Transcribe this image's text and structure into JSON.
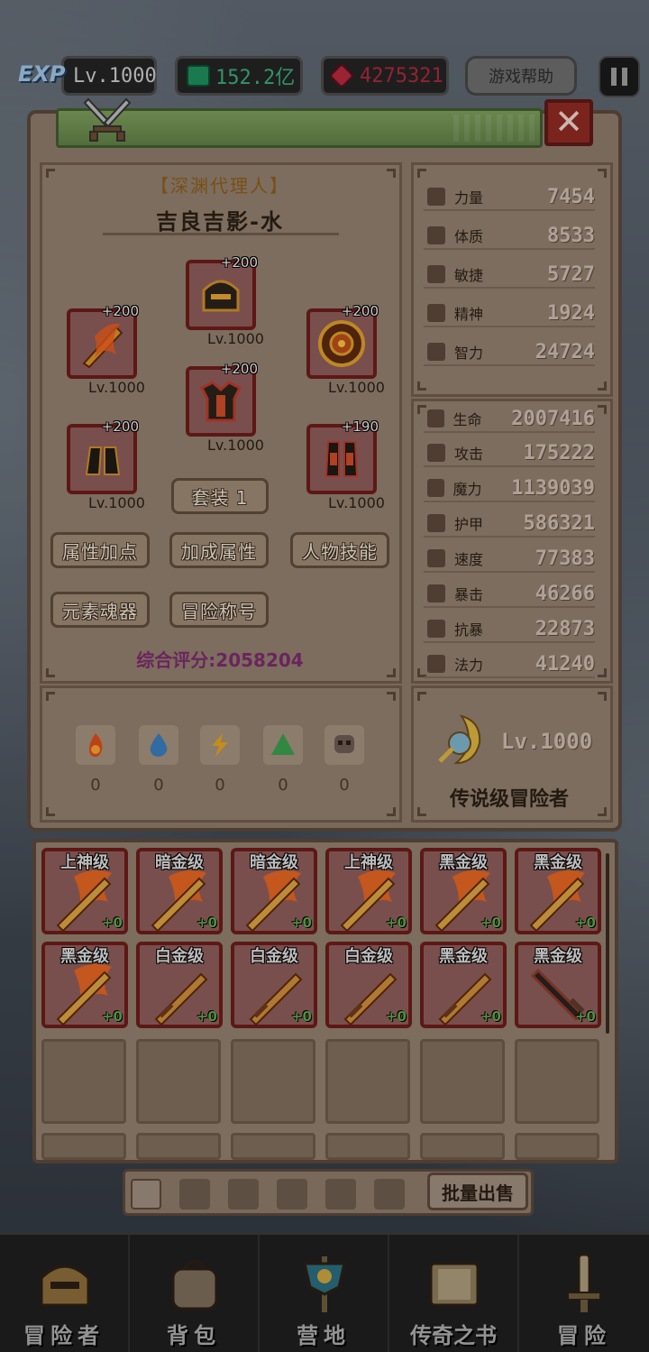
{
  "topbar": {
    "exp_badge": "EXP",
    "level": "Lv.1000",
    "gems": "152.2亿",
    "rubies": "4275321",
    "help": "游戏帮助"
  },
  "character": {
    "title": "【深渊代理人】",
    "name": "吉良吉影-水",
    "equipment": [
      {
        "plus": "+200",
        "level": "Lv.1000",
        "icon": "flame-sword-icon"
      },
      {
        "plus": "+200",
        "level": "Lv.1000",
        "icon": "helmet-icon"
      },
      {
        "plus": "+200",
        "level": "Lv.1000",
        "icon": "shield-icon"
      },
      {
        "plus": "+200",
        "level": "Lv.1000",
        "icon": "armor-icon"
      },
      {
        "plus": "+200",
        "level": "Lv.1000",
        "icon": "gauntlets-icon"
      },
      {
        "plus": "+190",
        "level": "Lv.1000",
        "icon": "boots-icon"
      }
    ],
    "set_button": "套装 1",
    "buttons": [
      "属性加点",
      "加成属性",
      "人物技能",
      "元素魂器",
      "冒险称号"
    ],
    "score": "综合评分:2058204"
  },
  "elements": [
    {
      "icon": "fire-element-icon",
      "value": "0"
    },
    {
      "icon": "water-element-icon",
      "value": "0"
    },
    {
      "icon": "thunder-element-icon",
      "value": "0"
    },
    {
      "icon": "wind-element-icon",
      "value": "0"
    },
    {
      "icon": "skull-element-icon",
      "value": "0"
    }
  ],
  "base_stats": [
    {
      "label": "力量",
      "value": "7454"
    },
    {
      "label": "体质",
      "value": "8533"
    },
    {
      "label": "敏捷",
      "value": "5727"
    },
    {
      "label": "精神",
      "value": "1924"
    },
    {
      "label": "智力",
      "value": "24724"
    }
  ],
  "combat_stats": [
    {
      "label": "生命",
      "value": "2007416"
    },
    {
      "label": "攻击",
      "value": "175222"
    },
    {
      "label": "魔力",
      "value": "1139039"
    },
    {
      "label": "护甲",
      "value": "586321"
    },
    {
      "label": "速度",
      "value": "77383"
    },
    {
      "label": "暴击",
      "value": "46266"
    },
    {
      "label": "抗暴",
      "value": "22873"
    },
    {
      "label": "法力",
      "value": "41240"
    }
  ],
  "rank": {
    "level": "Lv.1000",
    "title": "传说级冒险者"
  },
  "inventory": [
    {
      "tier": "上神级",
      "enh": "+0",
      "kind": "flame"
    },
    {
      "tier": "暗金级",
      "enh": "+0",
      "kind": "flame"
    },
    {
      "tier": "暗金级",
      "enh": "+0",
      "kind": "flame"
    },
    {
      "tier": "上神级",
      "enh": "+0",
      "kind": "flame"
    },
    {
      "tier": "黑金级",
      "enh": "+0",
      "kind": "flame"
    },
    {
      "tier": "黑金级",
      "enh": "+0",
      "kind": "flame"
    },
    {
      "tier": "黑金级",
      "enh": "+0",
      "kind": "flame"
    },
    {
      "tier": "白金级",
      "enh": "+0",
      "kind": "plain"
    },
    {
      "tier": "白金级",
      "enh": "+0",
      "kind": "plain"
    },
    {
      "tier": "白金级",
      "enh": "+0",
      "kind": "plain"
    },
    {
      "tier": "黑金级",
      "enh": "+0",
      "kind": "plain"
    },
    {
      "tier": "黑金级",
      "enh": "+0",
      "kind": "dark"
    }
  ],
  "inventory_tabs": [
    "sword-tab-icon",
    "armor-tab-icon",
    "helmet-tab-icon",
    "gauntlet-tab-icon",
    "pants-tab-icon",
    "accessory-tab-icon"
  ],
  "sell_button": "批量出售",
  "nav": [
    {
      "label": "冒险者",
      "icon": "knight-helmet-icon"
    },
    {
      "label": "背包",
      "icon": "backpack-icon"
    },
    {
      "label": "营地",
      "icon": "camp-banner-icon"
    },
    {
      "label": "传奇之书",
      "icon": "book-icon"
    },
    {
      "label": "冒险",
      "icon": "sword-nav-icon"
    }
  ],
  "colors": {
    "panel": "#8e7d6c",
    "border": "#5a463a",
    "equip_frame": "#6a1c18",
    "score": "#7a2a6a"
  }
}
